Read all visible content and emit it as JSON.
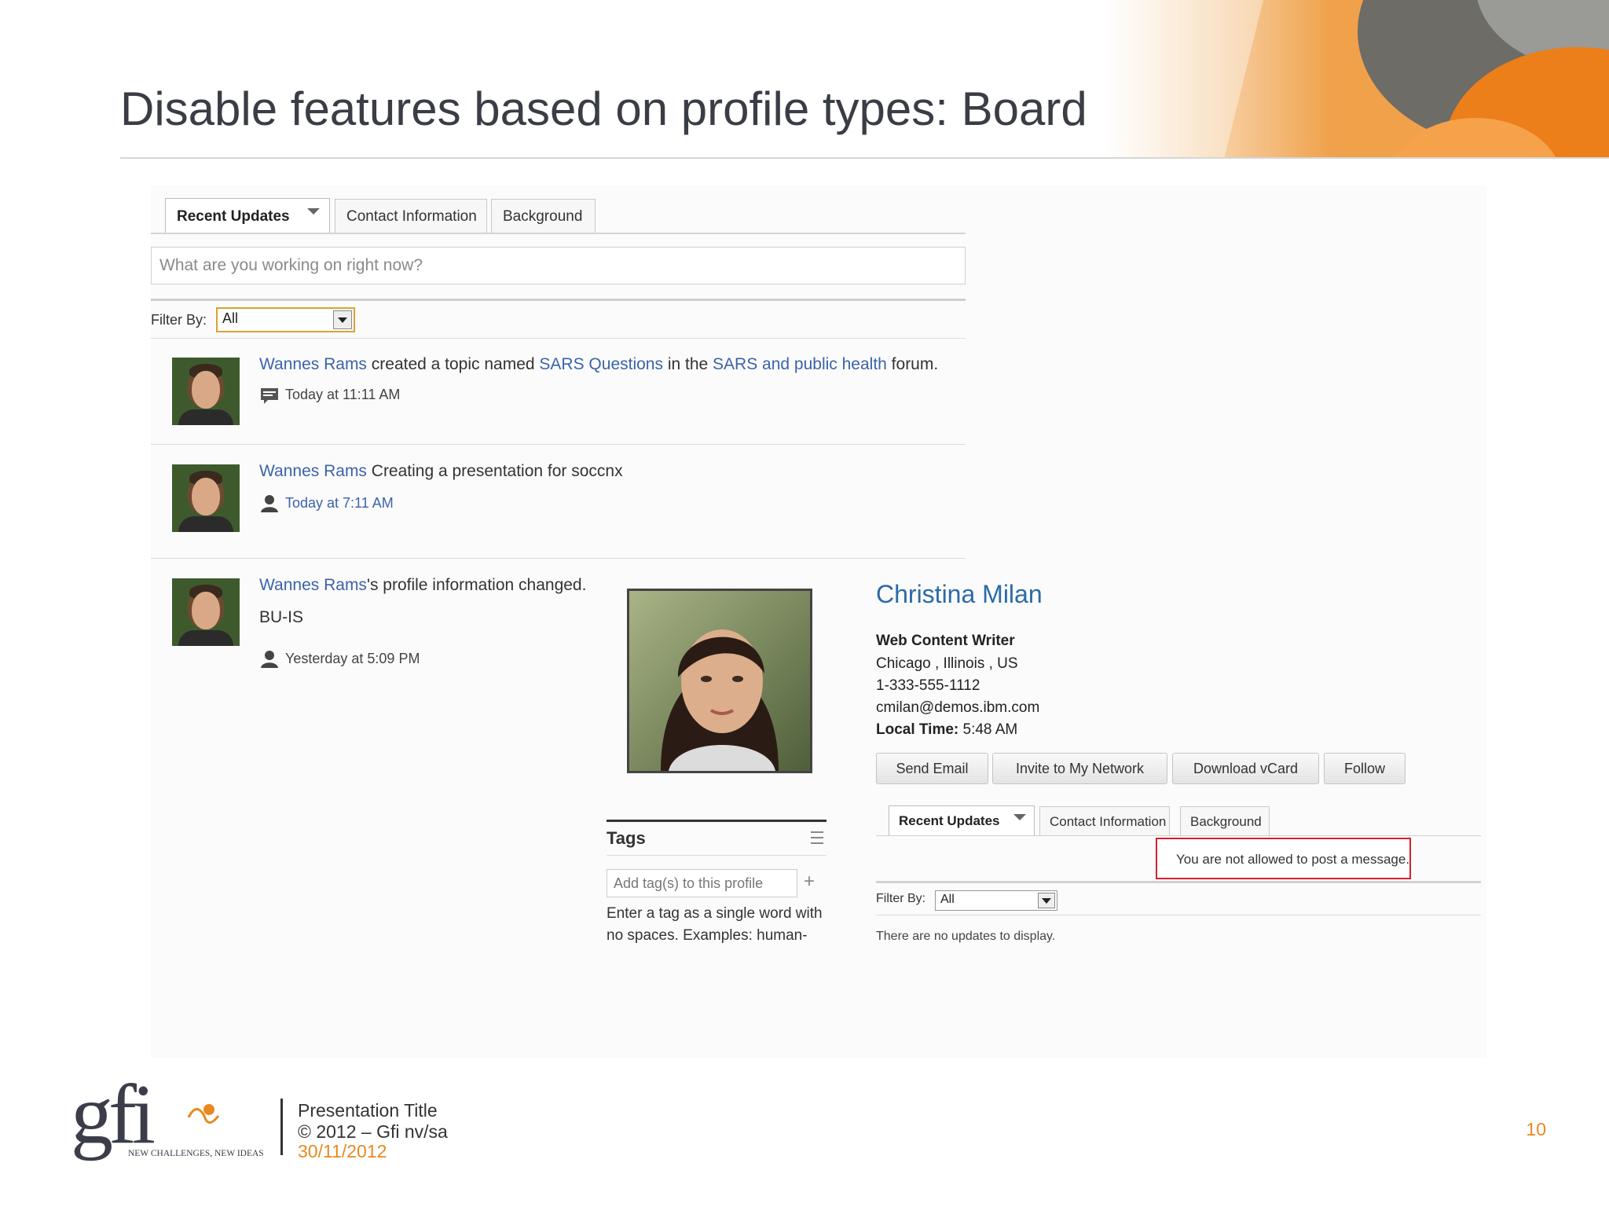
{
  "slide": {
    "title": "Disable features based on profile types: Board",
    "page_number": "10"
  },
  "feed_panel": {
    "tabs": [
      "Recent Updates",
      "Contact Information",
      "Background"
    ],
    "status_placeholder": "What are you working on right now?",
    "filter_label": "Filter By:",
    "filter_value": "All",
    "items": [
      {
        "user": "Wannes Rams",
        "text_1": " created a topic named ",
        "link_1": "SARS Questions",
        "text_2": " in the ",
        "link_2": "SARS and public health",
        "text_3": " forum.",
        "time": "Today at 11:11 AM",
        "icon": "comment-icon"
      },
      {
        "user": "Wannes Rams",
        "text_1": " Creating a presentation for soccnx",
        "time": "Today at 7:11 AM",
        "icon": "person-icon"
      },
      {
        "user": "Wannes Rams",
        "text_1": "'s profile information changed.",
        "detail": "BU-IS",
        "time": "Yesterday at 5:09 PM",
        "icon": "person-icon"
      }
    ]
  },
  "profile": {
    "name": "Christina Milan",
    "job_title": "Web Content Writer",
    "location": "Chicago , Illinois , US",
    "phone": "1-333-555-1112",
    "email": "cmilan@demos.ibm.com",
    "local_time_label": "Local Time:",
    "local_time": "5:48 AM",
    "buttons": [
      "Send Email",
      "Invite to My Network",
      "Download vCard",
      "Follow"
    ],
    "tabs": [
      "Recent Updates",
      "Contact Information",
      "Background"
    ],
    "notice": "You are not allowed to post a message.",
    "filter_label": "Filter By:",
    "filter_value": "All",
    "empty_text": "There are no updates to display."
  },
  "tags": {
    "title": "Tags",
    "input_placeholder": "Add tag(s) to this profile",
    "help_line_1": "Enter a tag as a single word with",
    "help_line_2": "no spaces. Examples: human-"
  },
  "footer": {
    "logo_text": "gfi",
    "tagline": "NEW CHALLENGES, NEW IDEAS",
    "presentation_title": "Presentation Title",
    "copyright": "© 2012 – Gfi nv/sa",
    "date": "30/11/2012"
  },
  "colors": {
    "link": "#3b63a8",
    "accent_orange": "#e8891f",
    "notice_border": "#d4212f"
  }
}
